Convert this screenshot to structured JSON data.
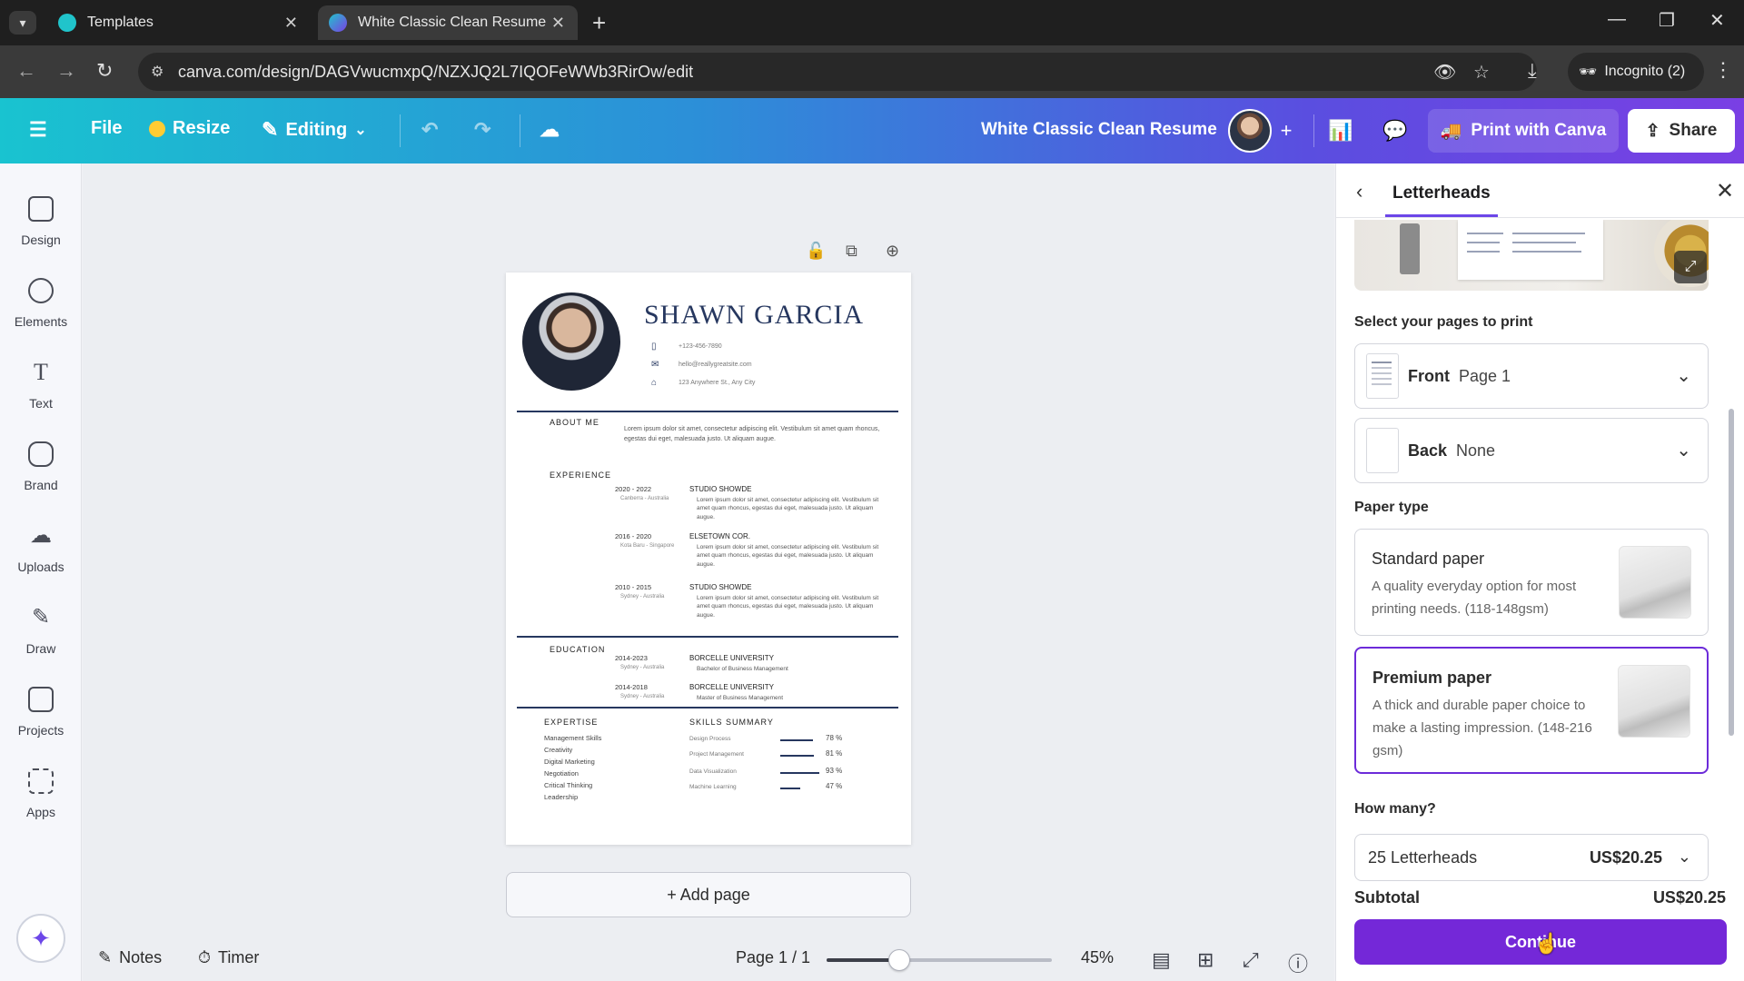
{
  "browser": {
    "tabs": [
      {
        "title": "Templates"
      },
      {
        "title": "White Classic Clean Resume - A"
      }
    ],
    "url": "canva.com/design/DAGVwucmxpQ/NZXJQ2L7IQOFeWWb3RirOw/edit",
    "incognito_label": "Incognito (2)"
  },
  "toolbar": {
    "file": "File",
    "resize": "Resize",
    "editing": "Editing",
    "doc_title": "White Classic Clean Resume",
    "print": "Print with Canva",
    "share": "Share"
  },
  "rail": [
    {
      "label": "Design"
    },
    {
      "label": "Elements"
    },
    {
      "label": "Text"
    },
    {
      "label": "Brand"
    },
    {
      "label": "Uploads"
    },
    {
      "label": "Draw"
    },
    {
      "label": "Projects"
    },
    {
      "label": "Apps"
    }
  ],
  "resume": {
    "name": "SHAWN GARCIA",
    "phone": "+123-456-7890",
    "email": "hello@reallygreatsite.com",
    "address": "123 Anywhere St., Any City",
    "about_title": "ABOUT ME",
    "about_text": "Lorem ipsum dolor sit amet, consectetur adipiscing elit. Vestibulum sit amet quam rhoncus, egestas dui eget, malesuada justo. Ut aliquam augue.",
    "experience_title": "EXPERIENCE",
    "experience": [
      {
        "years": "2020 - 2022",
        "location": "Canberra - Australia",
        "company": "STUDIO SHOWDE",
        "text": "Lorem ipsum dolor sit amet, consectetur adipiscing elit. Vestibulum sit amet quam rhoncus, egestas dui eget, malesuada justo. Ut aliquam augue."
      },
      {
        "years": "2016 - 2020",
        "location": "Kota Baru - Singapore",
        "company": "ELSETOWN COR.",
        "text": "Lorem ipsum dolor sit amet, consectetur adipiscing elit. Vestibulum sit amet quam rhoncus, egestas dui eget, malesuada justo. Ut aliquam augue."
      },
      {
        "years": "2010 - 2015",
        "location": "Sydney - Australia",
        "company": "STUDIO SHOWDE",
        "text": "Lorem ipsum dolor sit amet, consectetur adipiscing elit. Vestibulum sit amet quam rhoncus, egestas dui eget, malesuada justo. Ut aliquam augue."
      }
    ],
    "education_title": "EDUCATION",
    "education": [
      {
        "years": "2014-2023",
        "location": "Sydney - Australia",
        "school": "BORCELLE UNIVERSITY",
        "degree": "Bachelor of Business Management"
      },
      {
        "years": "2014-2018",
        "location": "Sydney - Australia",
        "school": "BORCELLE UNIVERSITY",
        "degree": "Master of Business Management"
      }
    ],
    "expertise_title": "EXPERTISE",
    "expertise": [
      "Management Skills",
      "Creativity",
      "Digital Marketing",
      "Negotiation",
      "Critical Thinking",
      "Leadership"
    ],
    "skills_title": "SKILLS SUMMARY",
    "skills": [
      {
        "name": "Design Process",
        "pct": "78 %",
        "value": 78
      },
      {
        "name": "Project Management",
        "pct": "81 %",
        "value": 81
      },
      {
        "name": "Data Visualization",
        "pct": "93 %",
        "value": 93
      },
      {
        "name": "Machine Learning",
        "pct": "47 %",
        "value": 47
      }
    ]
  },
  "canvas": {
    "add_page": "+ Add page"
  },
  "bottom": {
    "notes": "Notes",
    "timer": "Timer",
    "page_indicator": "Page 1 / 1",
    "zoom": "45%",
    "zoom_value": 45
  },
  "panel": {
    "title": "Letterheads",
    "select_pages_label": "Select your pages to print",
    "front": {
      "side": "Front",
      "value": "Page 1"
    },
    "back": {
      "side": "Back",
      "value": "None"
    },
    "paper_type_label": "Paper type",
    "papers": [
      {
        "title": "Standard paper",
        "desc": "A quality everyday option for most printing needs. (118-148gsm)",
        "selected": false
      },
      {
        "title": "Premium paper",
        "desc": "A thick and durable paper choice to make a lasting impression. (148-216 gsm)",
        "selected": true
      }
    ],
    "how_many_label": "How many?",
    "quantity": "25 Letterheads",
    "quantity_price": "US$20.25",
    "subtotal_label": "Subtotal",
    "subtotal_value": "US$20.25",
    "continue": "Continue"
  }
}
